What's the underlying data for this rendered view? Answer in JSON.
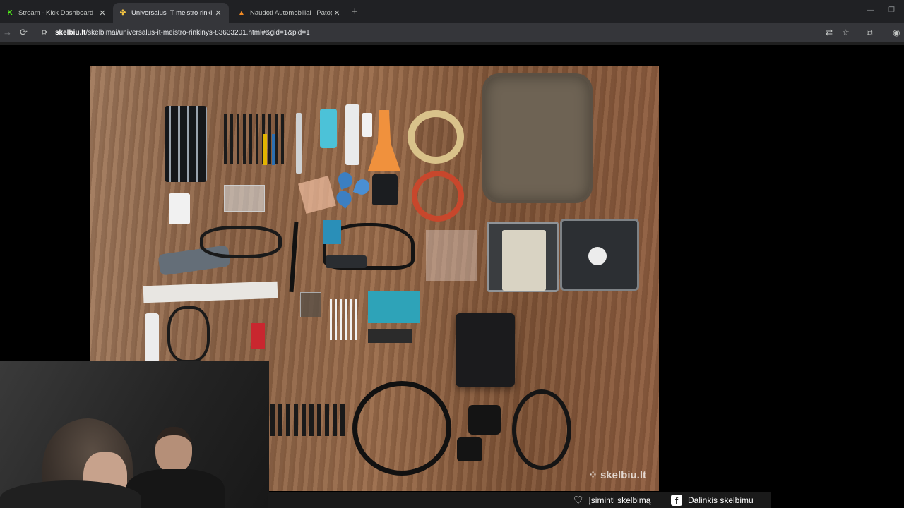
{
  "tabs": [
    {
      "title": "Stream - Kick Dashboard",
      "favicon": "K",
      "active": false
    },
    {
      "title": "Universalus IT meistro rinkinys",
      "favicon": "✣",
      "active": true
    },
    {
      "title": "Naudoti Automobiliai | Patogu",
      "favicon": "▲",
      "active": false
    }
  ],
  "address": {
    "domain": "skelbiu.lt",
    "path": "/skelbimai/universalus-it-meistro-rinkinys-83633201.html#&gid=1&pid=1"
  },
  "photo": {
    "watermark": "skelbiu.lt"
  },
  "actions": {
    "save_label": "Įsiminti skelbimą",
    "share_label": "Dalinkis skelbimu"
  },
  "colors": {
    "kick_green": "#53fc18",
    "tabbar": "#202124",
    "toolbar": "#35363a"
  }
}
